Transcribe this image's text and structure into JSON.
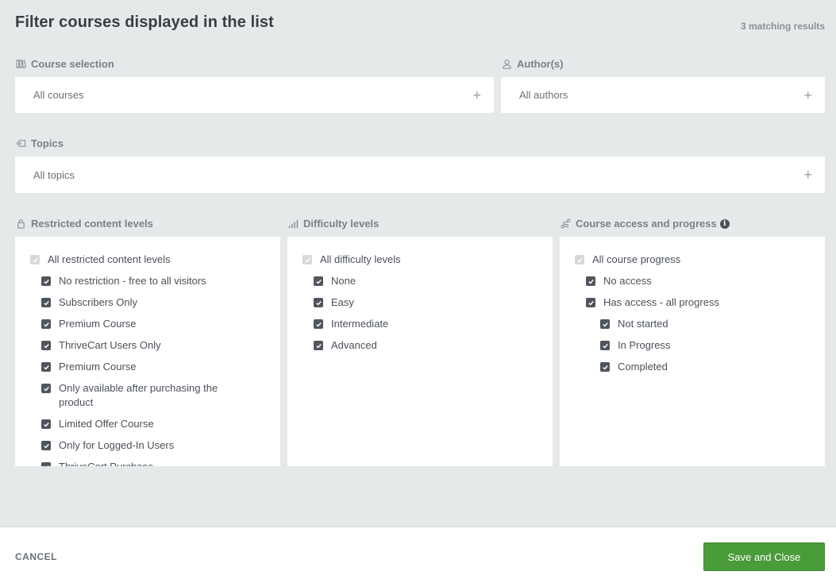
{
  "header": {
    "title": "Filter courses displayed in the list",
    "results": "3 matching results"
  },
  "course_selection": {
    "label": "Course selection",
    "icon": "books-icon",
    "value": "All courses"
  },
  "authors": {
    "label": "Author(s)",
    "icon": "user-icon",
    "value": "All authors"
  },
  "topics": {
    "label": "Topics",
    "icon": "tag-icon",
    "value": "All topics"
  },
  "restricted": {
    "label": "Restricted content levels",
    "icon": "lock-icon",
    "all": "All restricted content levels",
    "items": [
      "No restriction - free to all visitors",
      "Subscribers Only",
      "Premium Course",
      "ThriveCart Users Only",
      "Premium Course",
      "Only available after purchasing the product",
      "Limited Offer Course",
      "Only for Logged-In Users",
      "ThriveCart Purchase"
    ]
  },
  "difficulty": {
    "label": "Difficulty levels",
    "icon": "bars-icon",
    "all": "All difficulty levels",
    "items": [
      "None",
      "Easy",
      "Intermediate",
      "Advanced"
    ]
  },
  "progress": {
    "label": "Course access and progress",
    "icon": "route-icon",
    "info_icon": "info-icon",
    "all": "All course progress",
    "no_access": "No access",
    "has_access": "Has access - all progress",
    "sub_items": [
      "Not started",
      "In Progress",
      "Completed"
    ]
  },
  "footer": {
    "cancel": "CANCEL",
    "save": "Save and Close"
  },
  "colors": {
    "accent": "#4a9b3a",
    "background": "#e6e9ea",
    "checkbox": "#50565f"
  }
}
